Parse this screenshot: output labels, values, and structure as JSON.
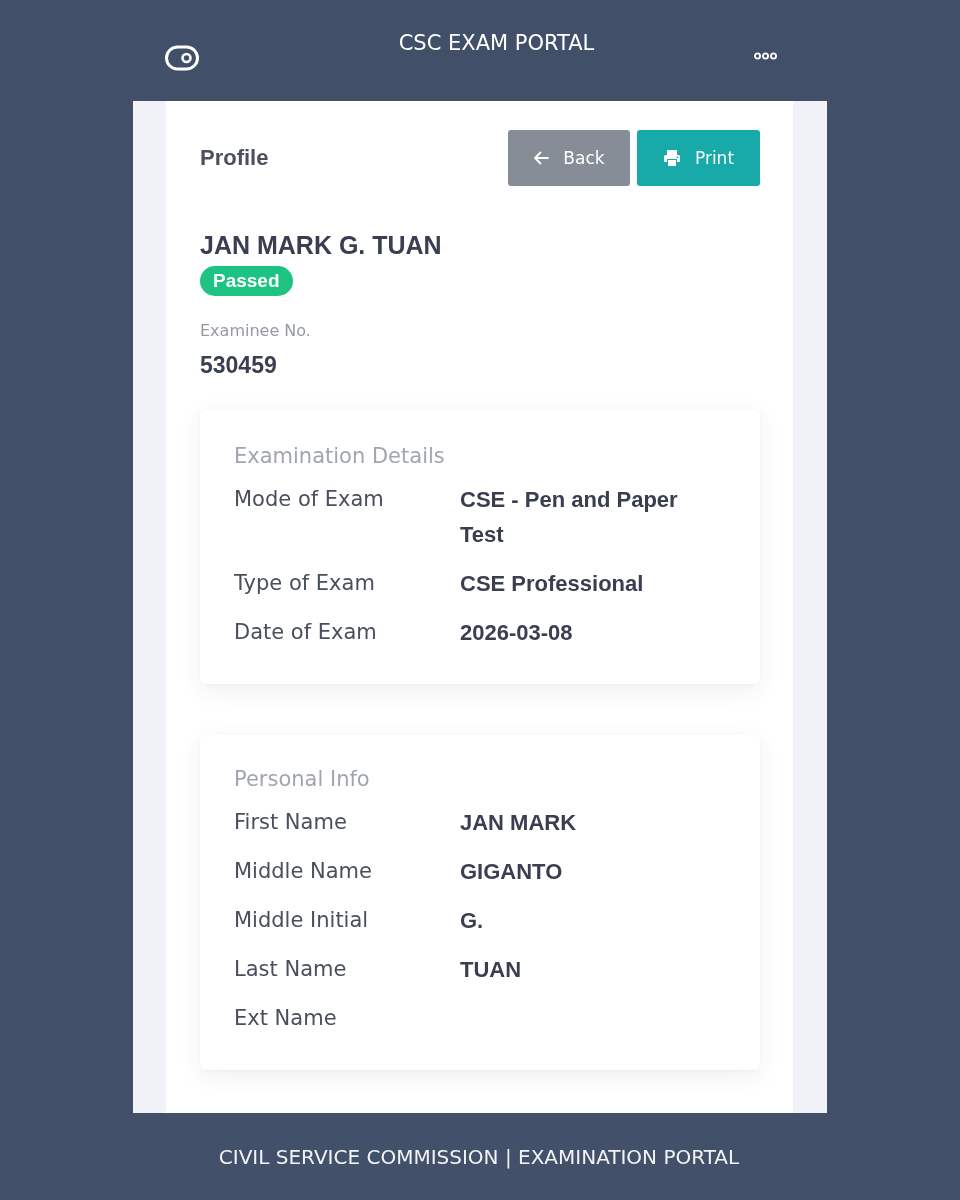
{
  "header": {
    "title": "CSC EXAM PORTAL"
  },
  "profile": {
    "heading": "Profile",
    "buttons": [
      {
        "label": "Back",
        "kind": "back"
      },
      {
        "label": "Print",
        "kind": "print"
      }
    ],
    "name": "JAN MARK G. TUAN",
    "status": {
      "label": "Passed",
      "kind": "passed"
    },
    "examinee_no": {
      "label": "Examinee No.",
      "value": "530459"
    }
  },
  "sections": [
    {
      "title": "Examination Details",
      "rows": [
        {
          "label": "Mode of Exam",
          "value": "CSE - Pen and Paper Test"
        },
        {
          "label": "Type of Exam",
          "value": "CSE Professional"
        },
        {
          "label": "Date of Exam",
          "value": "2026-03-08"
        }
      ]
    },
    {
      "title": "Personal Info",
      "rows": [
        {
          "label": "First Name",
          "value": "JAN MARK"
        },
        {
          "label": "Middle Name",
          "value": "GIGANTO"
        },
        {
          "label": "Middle Initial",
          "value": "G."
        },
        {
          "label": "Last Name",
          "value": "TUAN"
        },
        {
          "label": "Ext Name"
        }
      ]
    }
  ],
  "footer": {
    "text": "CIVIL SERVICE COMMISSION | EXAMINATION PORTAL"
  }
}
